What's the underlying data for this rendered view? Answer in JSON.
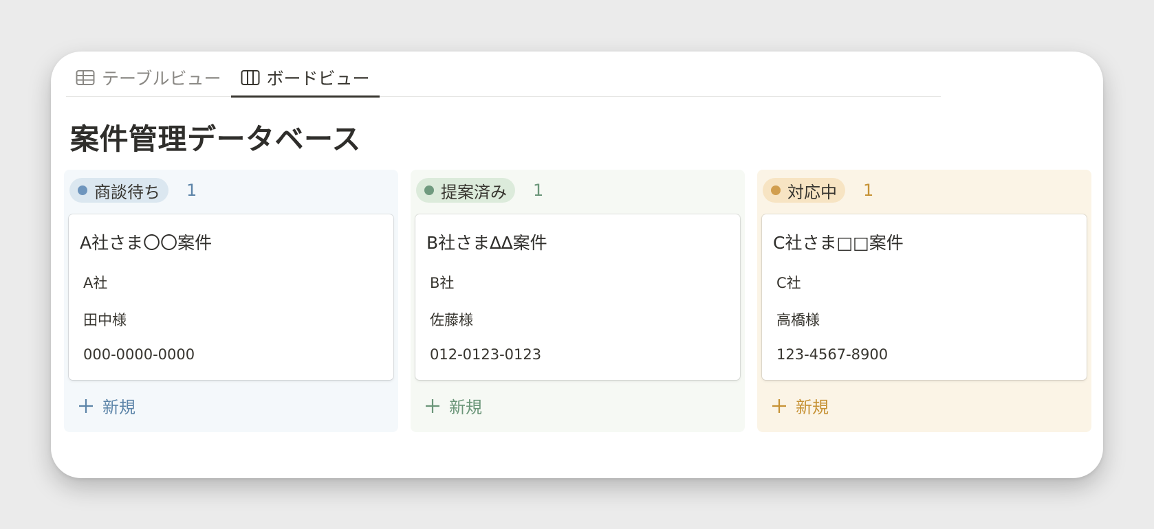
{
  "tabs": [
    {
      "label": "テーブルビュー",
      "icon": "table-icon",
      "active": false
    },
    {
      "label": "ボードビュー",
      "icon": "board-icon",
      "active": true
    }
  ],
  "page_title": "案件管理データベース",
  "columns": [
    {
      "status": "商談待ち",
      "count": "1",
      "colors": {
        "bg": "#f4f8fb",
        "pill": "#dbe7f0",
        "dot": "#6e95bd",
        "text": "#5c84a8"
      },
      "card": {
        "title": "A社さま〇〇案件",
        "company": "A社",
        "contact": "田中様",
        "phone": "000-0000-0000"
      },
      "new_label": "新規"
    },
    {
      "status": "提案済み",
      "count": "1",
      "colors": {
        "bg": "#f6f9f4",
        "pill": "#dcebdb",
        "dot": "#6f9a7e",
        "text": "#6b9679"
      },
      "card": {
        "title": "B社さま∆∆案件",
        "company": "B社",
        "contact": "佐藤様",
        "phone": "012-0123-0123"
      },
      "new_label": "新規"
    },
    {
      "status": "対応中",
      "count": "1",
      "colors": {
        "bg": "#fbf4e6",
        "pill": "#f7e4c3",
        "dot": "#d19e4e",
        "text": "#c69235"
      },
      "card": {
        "title": "C社さま□□案件",
        "company": "C社",
        "contact": "高橋様",
        "phone": "123-4567-8900"
      },
      "new_label": "新規"
    }
  ]
}
